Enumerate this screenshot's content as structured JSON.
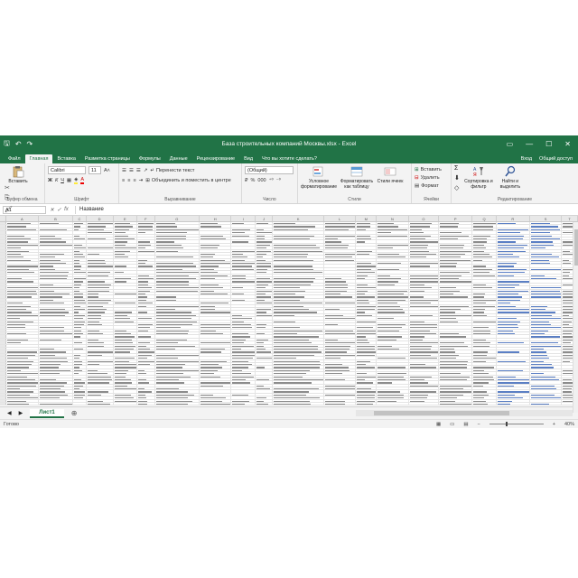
{
  "window": {
    "title": "База строительных компаний Москвы.xlsx - Excel",
    "controls": {
      "restore": "▭",
      "minimize": "—",
      "maximize": "☐",
      "close": "✕"
    }
  },
  "qat": {
    "save": "🖫",
    "undo": "↶",
    "redo": "↷"
  },
  "tabs": [
    {
      "label": "Файл"
    },
    {
      "label": "Главная"
    },
    {
      "label": "Вставка"
    },
    {
      "label": "Разметка страницы"
    },
    {
      "label": "Формулы"
    },
    {
      "label": "Данные"
    },
    {
      "label": "Рецензирование"
    },
    {
      "label": "Вид"
    },
    {
      "label": "Что вы хотите сделать?"
    }
  ],
  "tabs_right": {
    "signin": "Вход",
    "share": "Общий доступ"
  },
  "ribbon": {
    "clipboard": {
      "paste": "Вставить",
      "label": "Буфер обмена"
    },
    "font": {
      "name": "Calibri",
      "size": "11",
      "bold": "Ж",
      "italic": "К",
      "underline": "Ч",
      "grow": "A˄",
      "shrink": "A˅",
      "label": "Шрифт"
    },
    "alignment": {
      "wrap": "Перенести текст",
      "merge": "Объединить и поместить в центре",
      "label": "Выравнивание"
    },
    "number": {
      "format": "(Общий)",
      "percent": "%",
      "thousands": "000",
      "label": "Число"
    },
    "styles": {
      "conditional": "Условное форматирование",
      "table": "Форматировать как таблицу",
      "cell": "Стили ячеек",
      "label": "Стили"
    },
    "cells": {
      "insert": "Вставить",
      "delete": "Удалить",
      "format": "Формат",
      "label": "Ячейки"
    },
    "editing": {
      "sort": "Сортировка и фильтр",
      "find": "Найти и выделить",
      "label": "Редактирование"
    }
  },
  "formula_bar": {
    "name_box": "A1",
    "fx": "fx",
    "content": "Название"
  },
  "grid": {
    "columns": [
      "A",
      "B",
      "C",
      "D",
      "E",
      "F",
      "G",
      "H",
      "I",
      "J",
      "K",
      "L",
      "M",
      "N",
      "O",
      "P",
      "Q",
      "R",
      "S",
      "T"
    ],
    "rows_visible": 60
  },
  "sheet_tabs": [
    {
      "label": "Лист1"
    }
  ],
  "status": {
    "ready": "Готово",
    "zoom": "40%"
  }
}
